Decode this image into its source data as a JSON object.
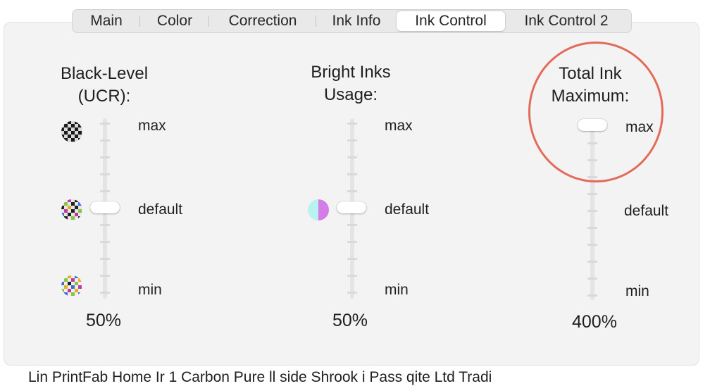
{
  "tabs": [
    {
      "label": "Main",
      "active": false
    },
    {
      "label": "Color",
      "active": false
    },
    {
      "label": "Correction",
      "active": false
    },
    {
      "label": "Ink Info",
      "active": false
    },
    {
      "label": "Ink Control",
      "active": true
    },
    {
      "label": "Ink Control 2",
      "active": false
    }
  ],
  "black_level": {
    "title_line1": "Black-Level",
    "title_line2": "(UCR):",
    "max_label": "max",
    "default_label": "default",
    "min_label": "min",
    "value": "50%",
    "slider_fraction": 0.5
  },
  "bright_inks": {
    "title_line1": "Bright Inks",
    "title_line2": "Usage:",
    "max_label": "max",
    "default_label": "default",
    "min_label": "min",
    "value": "50%",
    "slider_fraction": 0.5
  },
  "total_ink": {
    "title_line1": "Total Ink",
    "title_line2": "Maximum:",
    "max_label": "max",
    "default_label": "default",
    "min_label": "min",
    "value": "400%",
    "slider_fraction": 1.0
  },
  "footer_text": "Lin    PrintFab Home Ir 1    Carbon Pure ll side Shrook i Pass qite Ltd Tradi",
  "colors": {
    "highlight_circle": "#e36b5b",
    "panel_bg": "#f3f3f3"
  }
}
